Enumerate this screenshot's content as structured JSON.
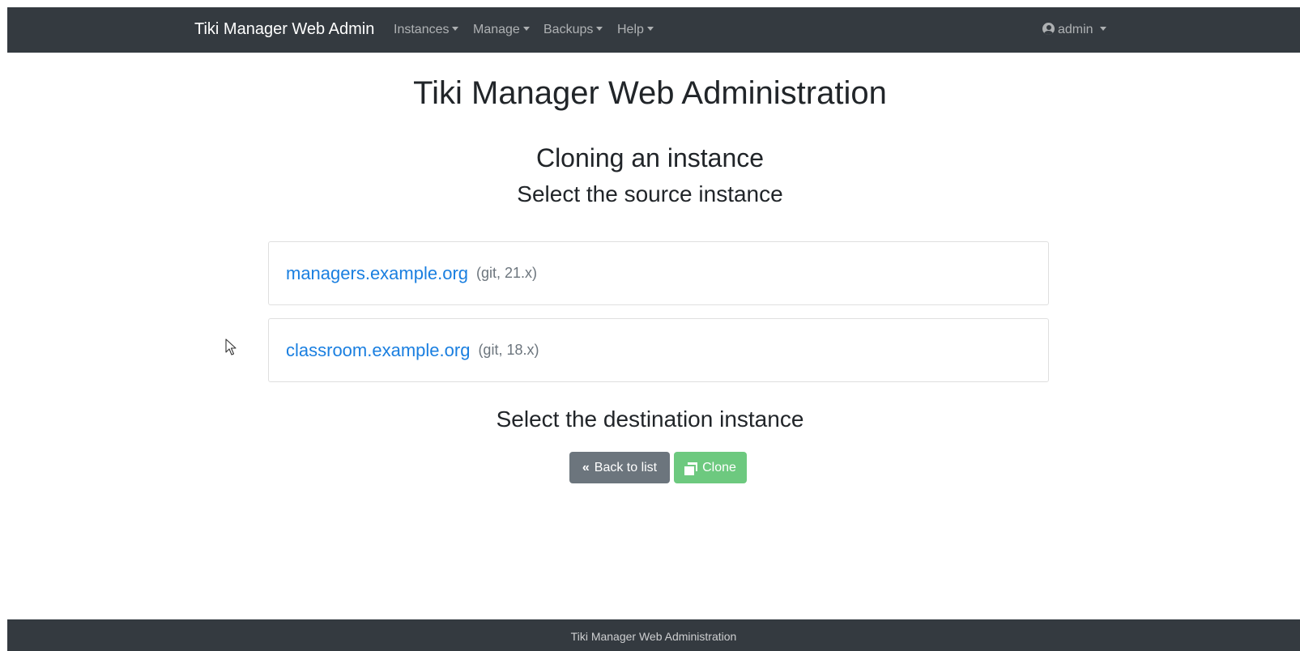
{
  "navbar": {
    "brand": "Tiki Manager Web Admin",
    "menus": [
      {
        "label": "Instances"
      },
      {
        "label": "Manage"
      },
      {
        "label": "Backups"
      },
      {
        "label": "Help"
      }
    ],
    "user": {
      "label": "admin",
      "icon": "user-circle-icon"
    }
  },
  "main": {
    "title": "Tiki Manager Web Administration",
    "subtitle": "Cloning an instance",
    "source_label": "Select the source instance",
    "instances": [
      {
        "name": "managers.example.org",
        "meta": "(git, 21.x)"
      },
      {
        "name": "classroom.example.org",
        "meta": "(git, 18.x)"
      }
    ],
    "destination_label": "Select the destination instance",
    "buttons": {
      "back": {
        "label": "Back to list",
        "icon": "double-chevron-left-icon"
      },
      "clone": {
        "label": "Clone",
        "icon": "clone-icon"
      }
    }
  },
  "footer": {
    "text": "Tiki Manager Web Administration"
  },
  "colors": {
    "navbar_bg": "#343a40",
    "link": "#1a7fe0",
    "secondary_button": "#6c757d",
    "success_button": "#6dc97f"
  }
}
